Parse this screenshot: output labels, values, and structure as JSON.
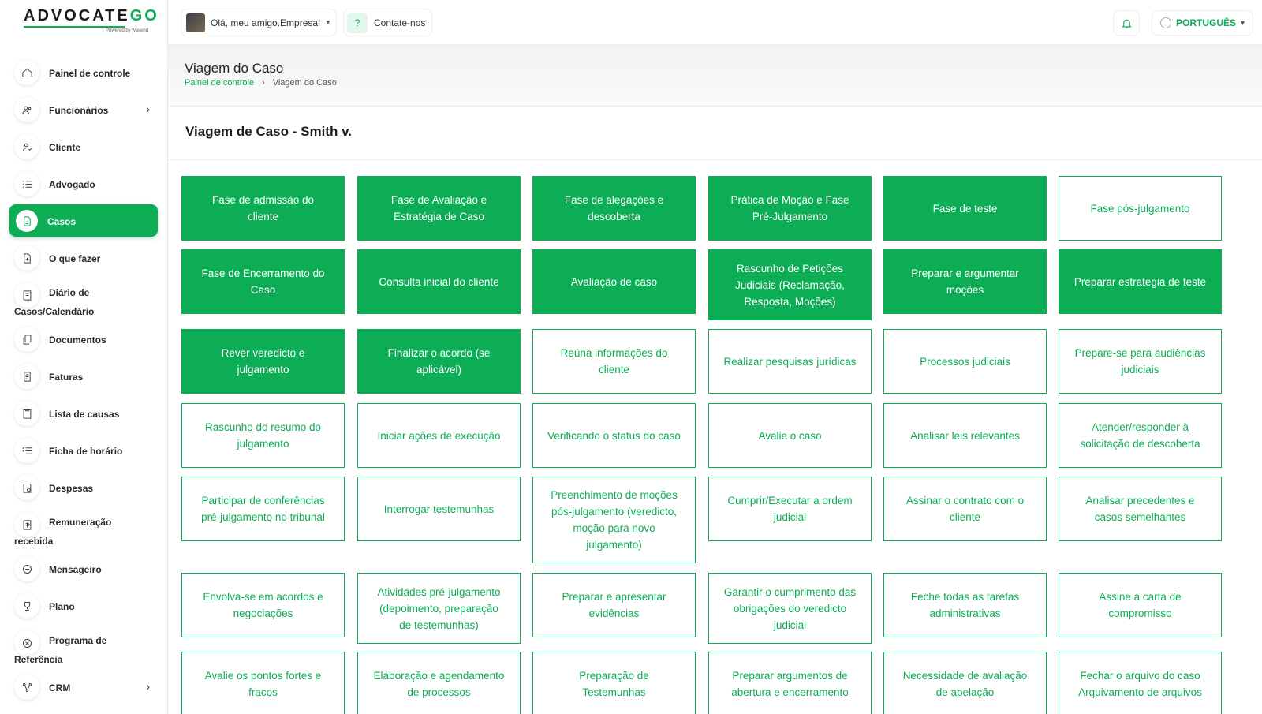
{
  "logo": {
    "brand_main": "ADVOCATE",
    "brand_accent": "GO",
    "powered": "Powered by wasend"
  },
  "sidebar": {
    "items": [
      {
        "label": "Painel de controle",
        "icon": "home-icon"
      },
      {
        "label": "Funcionários",
        "icon": "users-icon",
        "chevron": "›"
      },
      {
        "label": "Cliente",
        "icon": "client-icon"
      },
      {
        "label": "Advogado",
        "icon": "list-icon"
      },
      {
        "label": "Casos",
        "icon": "file-icon",
        "active": true
      },
      {
        "label": "O que fazer",
        "icon": "todo-icon"
      },
      {
        "label": "Diário de",
        "label2": "Casos/Calendário",
        "icon": "diary-icon"
      },
      {
        "label": "Documentos",
        "icon": "documents-icon"
      },
      {
        "label": "Faturas",
        "icon": "invoice-icon"
      },
      {
        "label": "Lista de causas",
        "icon": "clipboard-icon"
      },
      {
        "label": "Ficha de horário",
        "icon": "timesheet-icon"
      },
      {
        "label": "Despesas",
        "icon": "expenses-icon"
      },
      {
        "label": "Remuneração",
        "label2": "recebida",
        "icon": "payment-icon"
      },
      {
        "label": "Mensageiro",
        "icon": "chat-icon"
      },
      {
        "label": "Plano",
        "icon": "trophy-icon"
      },
      {
        "label": "Programa de",
        "label2": "Referência",
        "icon": "referral-icon"
      },
      {
        "label": "CRM",
        "icon": "crm-icon",
        "chevron": "›"
      }
    ]
  },
  "header": {
    "user_greeting": "Olá, meu amigo.Empresa!",
    "contact_label": "Contate-nos",
    "language": "PORTUGUÊS"
  },
  "page": {
    "title": "Viagem do Caso",
    "breadcrumb_home": "Painel de controle",
    "breadcrumb_sep": "›",
    "breadcrumb_current": "Viagem do Caso",
    "card_title": "Viagem de Caso - Smith v."
  },
  "colors": {
    "accent": "#0cad55"
  },
  "tiles": [
    {
      "label": "Fase de admissão do cliente",
      "done": true
    },
    {
      "label": "Fase de Avaliação e Estratégia de Caso",
      "done": true
    },
    {
      "label": "Fase de alegações e descoberta",
      "done": true
    },
    {
      "label": "Prática de Moção e Fase Pré-Julgamento",
      "done": true
    },
    {
      "label": "Fase de teste",
      "done": true
    },
    {
      "label": "Fase pós-julgamento",
      "done": false
    },
    {
      "label": "Fase de Encerramento do Caso",
      "done": true
    },
    {
      "label": "Consulta inicial do cliente",
      "done": true
    },
    {
      "label": "Avaliação de caso",
      "done": true
    },
    {
      "label": "Rascunho de Petições Judiciais (Reclamação, Resposta, Moções)",
      "done": true
    },
    {
      "label": "Preparar e argumentar moções",
      "done": true
    },
    {
      "label": "Preparar estratégia de teste",
      "done": true
    },
    {
      "label": "Rever veredicto e julgamento",
      "done": true
    },
    {
      "label": "Finalizar o acordo (se aplicável)",
      "done": true
    },
    {
      "label": "Reúna informações do cliente",
      "done": false
    },
    {
      "label": "Realizar pesquisas jurídicas",
      "done": false
    },
    {
      "label": "Processos judiciais",
      "done": false
    },
    {
      "label": "Prepare-se para audiências judiciais",
      "done": false
    },
    {
      "label": "Rascunho do resumo do julgamento",
      "done": false
    },
    {
      "label": "Iniciar ações de execução",
      "done": false
    },
    {
      "label": "Verificando o status do caso",
      "done": false
    },
    {
      "label": "Avalie o caso",
      "done": false
    },
    {
      "label": "Analisar leis relevantes",
      "done": false
    },
    {
      "label": "Atender/responder à solicitação de descoberta",
      "done": false
    },
    {
      "label": "Participar de conferências pré-julgamento no tribunal",
      "done": false
    },
    {
      "label": "Interrogar testemunhas",
      "done": false
    },
    {
      "label": "Preenchimento de moções pós-julgamento (veredicto, moção para novo julgamento)",
      "done": false
    },
    {
      "label": "Cumprir/Executar a ordem judicial",
      "done": false
    },
    {
      "label": "Assinar o contrato com o cliente",
      "done": false
    },
    {
      "label": "Analisar precedentes e casos semelhantes",
      "done": false
    },
    {
      "label": "Envolva-se em acordos e negociações",
      "done": false
    },
    {
      "label": "Atividades pré-julgamento (depoimento, preparação de testemunhas)",
      "done": false
    },
    {
      "label": "Preparar e apresentar evidências",
      "done": false
    },
    {
      "label": "Garantir o cumprimento das obrigações do veredicto judicial",
      "done": false
    },
    {
      "label": "Feche todas as tarefas administrativas",
      "done": false
    },
    {
      "label": "Assine a carta de compromisso",
      "done": false
    },
    {
      "label": "Avalie os pontos fortes e fracos",
      "done": false
    },
    {
      "label": "Elaboração e agendamento de processos",
      "done": false
    },
    {
      "label": "Preparação de Testemunhas",
      "done": false
    },
    {
      "label": "Preparar argumentos de abertura e encerramento",
      "done": false
    },
    {
      "label": "Necessidade de avaliação de apelação",
      "done": false
    },
    {
      "label": "Fechar o arquivo do caso Arquivamento de arquivos",
      "done": false
    }
  ]
}
